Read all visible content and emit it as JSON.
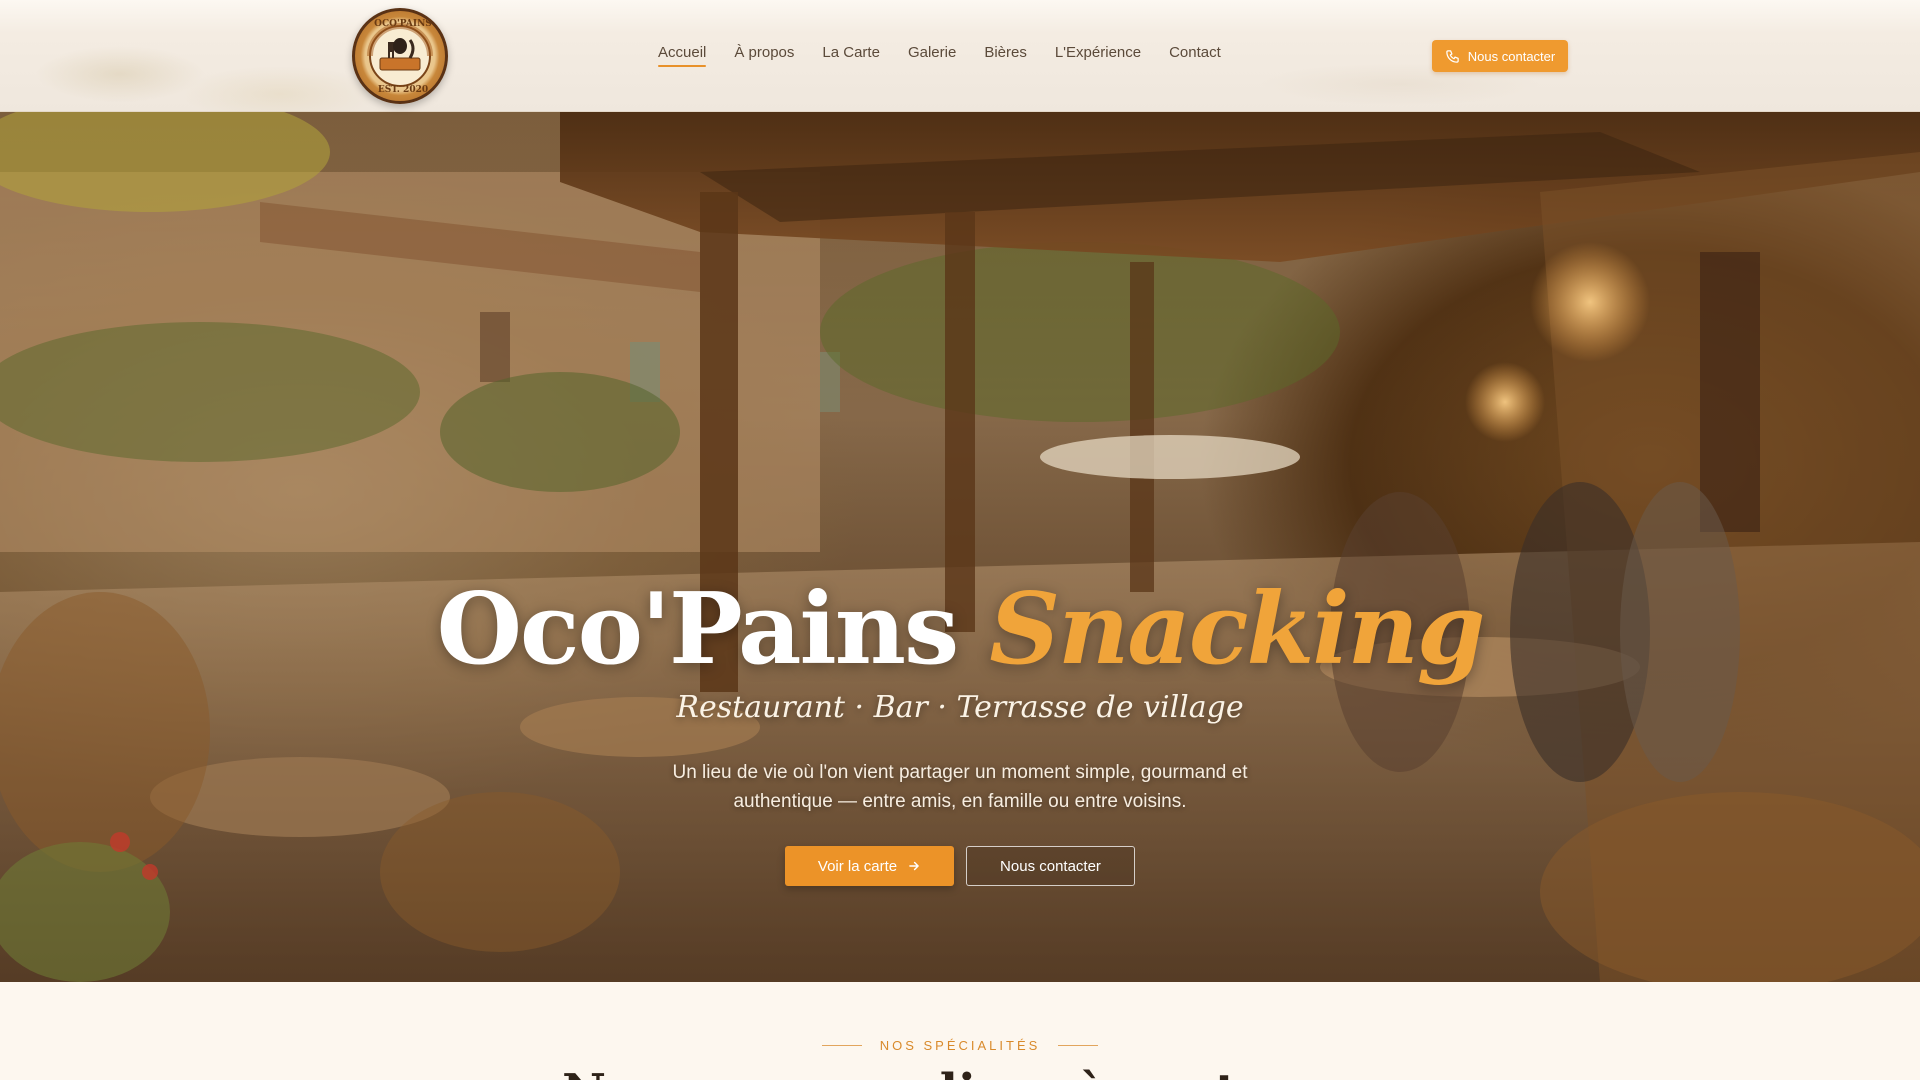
{
  "header": {
    "logo_text_top": "OCO'PAINS",
    "logo_text_bottom": "EST. 2020",
    "nav": [
      {
        "label": "Accueil",
        "active": true
      },
      {
        "label": "À propos"
      },
      {
        "label": "La Carte"
      },
      {
        "label": "Galerie"
      },
      {
        "label": "Bières"
      },
      {
        "label": "L'Expérience"
      },
      {
        "label": "Contact"
      }
    ],
    "cta_label": "Nous contacter",
    "cta_icon": "phone-icon"
  },
  "hero": {
    "title_main": "Oco'Pains",
    "title_accent": "Snacking",
    "subtitle": "Restaurant · Bar · Terrasse de village",
    "description": "Un lieu de vie où l'on vient partager un moment simple, gourmand et authentique — entre amis, en famille ou entre voisins.",
    "primary_button": "Voir la carte",
    "primary_icon": "arrow-right-icon",
    "secondary_button": "Nous contacter"
  },
  "specialties": {
    "eyebrow": "NOS SPÉCIALITÉS",
    "heading": "Nos gourmandises à partager"
  },
  "colors": {
    "accent": "#ec9328",
    "background": "#fdf7ef",
    "text_dark": "#5b4a3a"
  }
}
